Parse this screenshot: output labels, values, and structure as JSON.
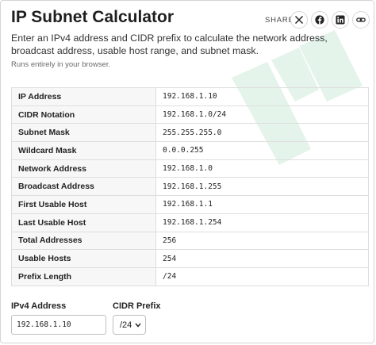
{
  "header": {
    "title": "IP Subnet Calculator",
    "description": "Enter an IPv4 address and CIDR prefix to calculate the network address, broadcast address, usable host range, and subnet mask.",
    "note": "Runs entirely in your browser."
  },
  "share": {
    "label": "SHARE",
    "buttons": [
      {
        "icon": "x-icon"
      },
      {
        "icon": "facebook-icon"
      },
      {
        "icon": "linkedin-icon"
      },
      {
        "icon": "link-icon"
      }
    ]
  },
  "results": [
    {
      "label": "IP Address",
      "value": "192.168.1.10"
    },
    {
      "label": "CIDR Notation",
      "value": "192.168.1.0/24"
    },
    {
      "label": "Subnet Mask",
      "value": "255.255.255.0"
    },
    {
      "label": "Wildcard Mask",
      "value": "0.0.0.255"
    },
    {
      "label": "Network Address",
      "value": "192.168.1.0"
    },
    {
      "label": "Broadcast Address",
      "value": "192.168.1.255"
    },
    {
      "label": "First Usable Host",
      "value": "192.168.1.1"
    },
    {
      "label": "Last Usable Host",
      "value": "192.168.1.254"
    },
    {
      "label": "Total Addresses",
      "value": "256"
    },
    {
      "label": "Usable Hosts",
      "value": "254"
    },
    {
      "label": "Prefix Length",
      "value": "/24"
    }
  ],
  "form": {
    "ip_label": "IPv4 Address",
    "ip_value": "192.168.1.10",
    "cidr_label": "CIDR Prefix",
    "cidr_value": "/24"
  },
  "colors": {
    "watermark": "#e4f4ea",
    "border": "#dedede",
    "label_bg": "#f7f7f7"
  }
}
